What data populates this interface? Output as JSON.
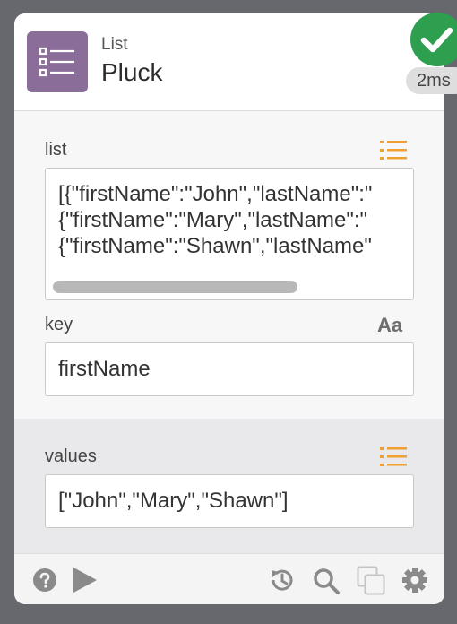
{
  "node": {
    "category": "List",
    "title": "Pluck",
    "icon": "list-icon",
    "accent_color": "#8a6d99"
  },
  "status": {
    "icon": "check-icon",
    "color": "#2d9f4f",
    "timing": "2ms"
  },
  "inputs": {
    "list": {
      "label": "list",
      "type_icon": "list-type-icon",
      "lines": [
        "[{\"firstName\":\"John\",\"lastName\":\"",
        "{\"firstName\":\"Mary\",\"lastName\":\"",
        "{\"firstName\":\"Shawn\",\"lastName\""
      ]
    },
    "key": {
      "label": "key",
      "type_text": "Aa",
      "value": "firstName"
    }
  },
  "outputs": {
    "values": {
      "label": "values",
      "type_icon": "list-type-icon",
      "value": "[\"John\",\"Mary\",\"Shawn\"]"
    }
  },
  "footer": {
    "icons": [
      "help-icon",
      "play-icon",
      "history-icon",
      "search-icon",
      "duplicate-icon",
      "settings-icon"
    ]
  },
  "colors": {
    "type_icon": "#f0a030",
    "background": "#67686d"
  }
}
